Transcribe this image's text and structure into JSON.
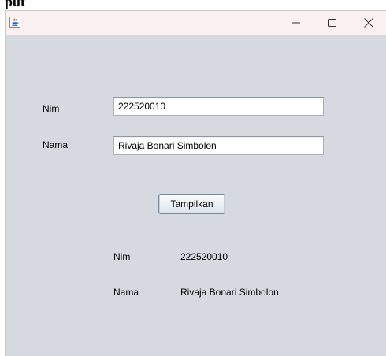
{
  "page": {
    "heading": "put"
  },
  "window": {
    "title": "",
    "icon": "java-icon",
    "controls": {
      "minimize_icon": "minimize-icon",
      "maximize_icon": "maximize-icon",
      "close_icon": "close-icon"
    }
  },
  "form": {
    "nim_label": "Nim",
    "nim_value": "222520010",
    "nama_label": "Nama",
    "nama_value": "Rivaja Bonari Simbolon",
    "button_label": "Tampilkan"
  },
  "output": {
    "nim_label": "Nim",
    "nim_value": "222520010",
    "nama_label": "Nama",
    "nama_value": "Rivaja Bonari Simbolon"
  },
  "colors": {
    "window_background": "#d6d9df",
    "titlebar_background": "#fbf0f0",
    "field_border": "#a9b1bb",
    "button_focus_ring": "#b8cfe5"
  }
}
